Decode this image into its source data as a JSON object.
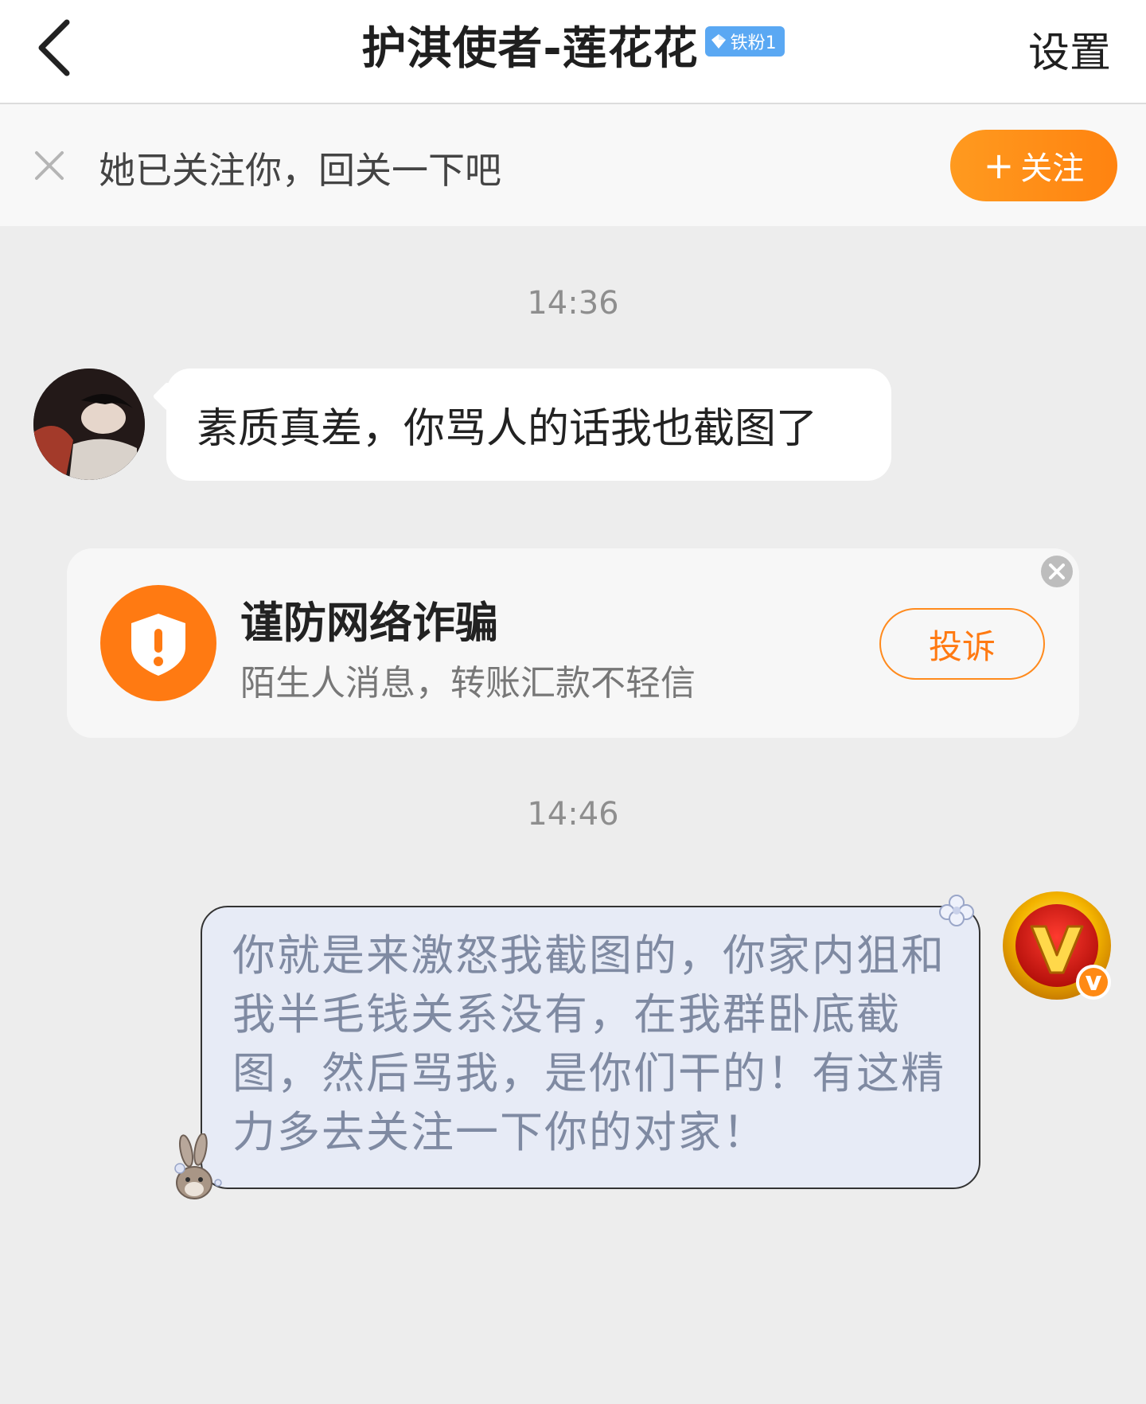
{
  "header": {
    "title": "护淇使者-莲花花",
    "fan_badge": "铁粉1",
    "settings_label": "设置",
    "badge_color": "#5aa8f3"
  },
  "follow_banner": {
    "text": "她已关注你，回关一下吧",
    "button_label": "关注",
    "button_color": "#ff8a14"
  },
  "messages": [
    {
      "time": "14:36",
      "direction": "incoming",
      "text": "素质真差，你骂人的话我也截图了"
    },
    {
      "time": "14:46",
      "direction": "outgoing",
      "text": "你就是来激怒我截图的，你家内狙和我半毛钱关系没有，在我群卧底截图，然后骂我，是你们干的！有这精力多去关注一下你的对家！"
    }
  ],
  "fraud_card": {
    "title": "谨防网络诈骗",
    "subtitle": "陌生人消息，转账汇款不轻信",
    "report_label": "投诉",
    "accent_color": "#ff7a12"
  },
  "icons": {
    "back": "chevron-left-icon",
    "close": "close-icon",
    "shield": "shield-exclamation-icon",
    "vip_avatar": "vip-v-badge-icon"
  }
}
